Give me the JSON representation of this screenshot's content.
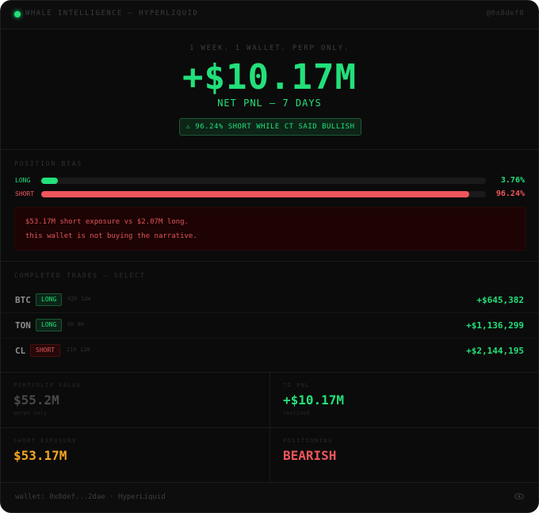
{
  "header": {
    "brand": "WHALE INTELLIGENCE — HYPERLIQUID",
    "handle": "@0x8def0",
    "status_color": "#22e07a"
  },
  "hero": {
    "tagline": "1 WEEK. 1 WALLET. PERP ONLY.",
    "net_pnl": "+$10.17M",
    "net_pnl_label": "NET PNL — 7 DAYS",
    "alert_icon": "warning-icon",
    "alert_text": "⚠ 96.24% SHORT WHILE CT SAID BULLISH"
  },
  "bias": {
    "title": "POSITION BIAS",
    "long": {
      "label": "LONG",
      "percent": 3.76,
      "percent_text": "3.76%",
      "color": "#22e07a"
    },
    "short": {
      "label": "SHORT",
      "percent": 96.24,
      "percent_text": "96.24%",
      "color": "#f0555a"
    },
    "note_lines": [
      "$53.17M short exposure vs $2.07M long.",
      "this wallet is not buying the narrative."
    ]
  },
  "trades": {
    "title": "COMPLETED TRADES — SELECT",
    "rows": [
      {
        "asset": "BTC",
        "side": "LONG",
        "duration": "42h 12m",
        "pnl": "+$645,382"
      },
      {
        "asset": "TON",
        "side": "LONG",
        "duration": "6h 8m",
        "pnl": "+$1,136,299"
      },
      {
        "asset": "CL",
        "side": "SHORT",
        "duration": "21h 12m",
        "pnl": "+$2,144,195"
      }
    ]
  },
  "stats": {
    "portfolio": {
      "label": "PORTFOLIO VALUE",
      "value": "$55.2M",
      "sub": "perps only",
      "color": "#4a4a4a"
    },
    "pnl_7d": {
      "label": "7D PNL",
      "value": "+$10.17M",
      "sub": "realized",
      "color": "#22e07a"
    },
    "short_exposure": {
      "label": "SHORT EXPOSURE",
      "value": "$53.17M",
      "sub": "",
      "color": "#f5a623"
    },
    "positioning": {
      "label": "POSITIONING",
      "value": "BEARISH",
      "sub": "",
      "color": "#f0555a"
    }
  },
  "footer": {
    "wallet": "wallet: 0x8def...2dae · HyperLiquid",
    "eye_icon": "eye-icon"
  }
}
